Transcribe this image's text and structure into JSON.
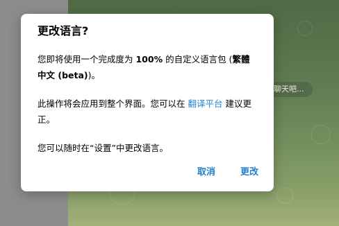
{
  "dialog": {
    "title": "更改语言?",
    "para1_pre": "您即将使用一个完成度为 ",
    "percent": "100%",
    "para1_mid": " 的自定义语言包 (",
    "language_name": "繁體中文 (beta)",
    "para1_post": ")。",
    "para2_pre": "此操作将会应用到整个界面。您可以在 ",
    "translation_platform_link": "翻译平台",
    "para2_post": " 建议更正。",
    "para3": "您可以随时在“设置”中更改语言。",
    "cancel_label": "取消",
    "confirm_label": "更改"
  },
  "background": {
    "chat_bubble_text": "聊天吧..."
  },
  "colors": {
    "accent": "#2481cc",
    "overlay": "#8c8c8c",
    "chat_background": "#5d7a51"
  }
}
